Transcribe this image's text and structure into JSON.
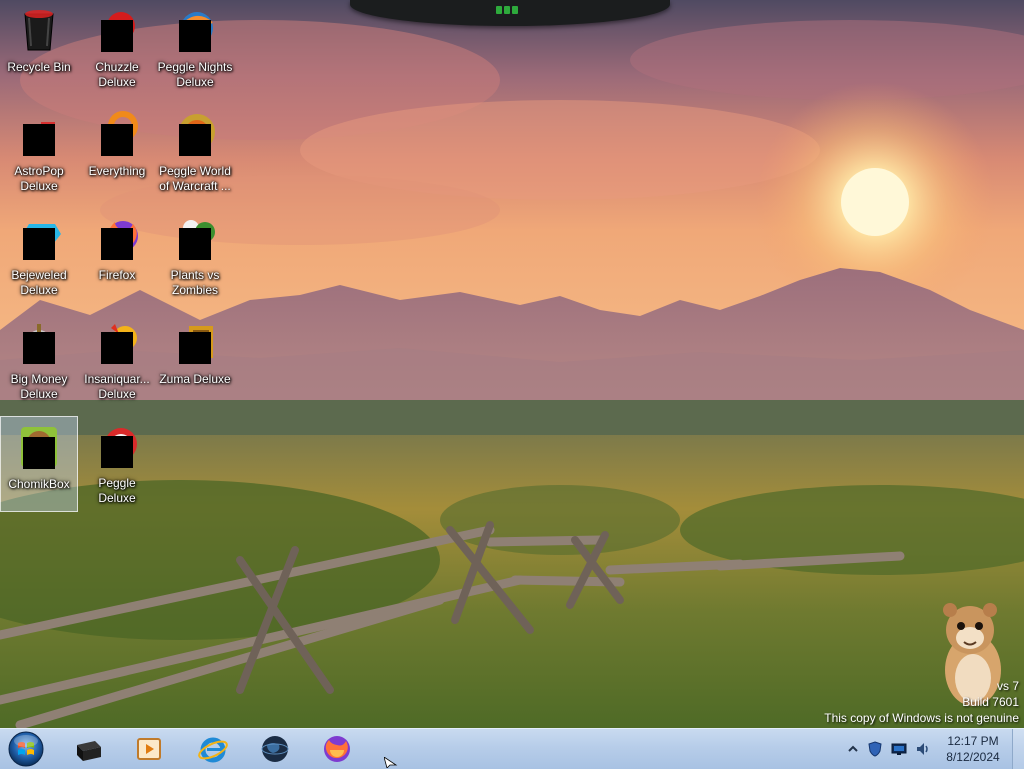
{
  "desktop": {
    "icons": [
      {
        "label": "Recycle Bin",
        "icon": "recycle-bin-icon",
        "redacted": false,
        "selected": false
      },
      {
        "label": "Chuzzle\nDeluxe",
        "icon": "chuzzle-deluxe-icon",
        "redacted": true,
        "selected": false
      },
      {
        "label": "Peggle Nights\nDeluxe",
        "icon": "peggle-nights-icon",
        "redacted": true,
        "selected": false
      },
      {
        "label": "AstroPop\nDeluxe",
        "icon": "astropop-icon",
        "redacted": true,
        "selected": false
      },
      {
        "label": "Everything",
        "icon": "everything-search-icon",
        "redacted": true,
        "selected": false
      },
      {
        "label": "Peggle World\nof Warcraft ...",
        "icon": "peggle-wow-icon",
        "redacted": true,
        "selected": false
      },
      {
        "label": "Bejeweled\nDeluxe",
        "icon": "bejeweled-icon",
        "redacted": true,
        "selected": false
      },
      {
        "label": "Firefox",
        "icon": "firefox-icon",
        "redacted": true,
        "selected": false
      },
      {
        "label": "Plants vs\nZombies",
        "icon": "plants-vs-zombies-icon",
        "redacted": true,
        "selected": false
      },
      {
        "label": "Big Money\nDeluxe",
        "icon": "big-money-icon",
        "redacted": true,
        "selected": false
      },
      {
        "label": "Insaniquar...\nDeluxe",
        "icon": "insaniquarium-icon",
        "redacted": true,
        "selected": false
      },
      {
        "label": "Zuma Deluxe",
        "icon": "zuma-deluxe-icon",
        "redacted": true,
        "selected": false
      },
      {
        "label": "ChomikBox",
        "icon": "chomikbox-icon",
        "redacted": true,
        "selected": true
      },
      {
        "label": "Peggle Deluxe",
        "icon": "peggle-deluxe-icon",
        "redacted": true,
        "selected": false
      }
    ]
  },
  "watermark": {
    "line1": "vs 7",
    "line2": "Build 7601",
    "line3": "This copy of Windows is not genuine"
  },
  "taskbar": {
    "start": "windows-start-orb-icon",
    "pinned": [
      {
        "name": "taskbar-terminal",
        "icon": "black-box-icon"
      },
      {
        "name": "taskbar-media-player",
        "icon": "media-player-icon"
      },
      {
        "name": "taskbar-internet-explorer",
        "icon": "internet-explorer-icon"
      },
      {
        "name": "taskbar-globe",
        "icon": "globe-icon"
      },
      {
        "name": "taskbar-firefox",
        "icon": "firefox-icon"
      }
    ],
    "tray": {
      "time": "12:17 PM",
      "date": "8/12/2024",
      "icons": [
        "show-hidden-icons-chevron",
        "action-center-shield-icon",
        "network-monitor-icon",
        "volume-speaker-icon"
      ]
    }
  },
  "colors": {
    "taskbar": "#b7cde9",
    "sky_top": "#5b4e63",
    "sun": "#fff6c8",
    "field": "#9a8a3a"
  }
}
